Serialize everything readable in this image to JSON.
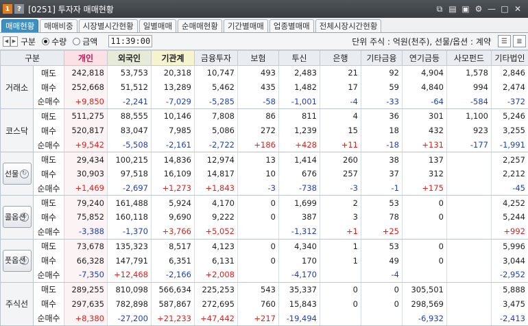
{
  "window": {
    "badge_one": "1",
    "badge_q": "?",
    "title": "[0251] 투자자 매매현황",
    "icons": [
      "link-icon",
      "export-icon",
      "camera-icon",
      "gear-icon",
      "minimize-icon",
      "maximize-icon",
      "close-icon"
    ]
  },
  "tabs": [
    "매매현황",
    "매매비중",
    "시장별시간현황",
    "일별매매",
    "순매매현황",
    "기간별매매",
    "업종별매매",
    "전체시장시간현황"
  ],
  "active_tab": 0,
  "toolbar": {
    "label": "구분",
    "radio_qty": "수량",
    "radio_amt": "금액",
    "time": "11:39:00",
    "unit": "단위 주식 : 억원(천주), 선물/옵션 : 계약"
  },
  "headers": [
    "구분",
    "개인",
    "외국인",
    "기관계",
    "금융투자",
    "보험",
    "투신",
    "은행",
    "기타금융",
    "연기금등",
    "사모펀드",
    "기타법인"
  ],
  "row_labels": {
    "sell": "매도",
    "buy": "매수",
    "net": "순매수"
  },
  "groups": [
    {
      "name": "거래소",
      "button": false,
      "sell": [
        "242,818",
        "53,753",
        "20,318",
        "10,747",
        "493",
        "2,483",
        "21",
        "92",
        "4,904",
        "1,578",
        "2,846"
      ],
      "buy": [
        "252,668",
        "51,512",
        "13,289",
        "5,462",
        "435",
        "1,482",
        "17",
        "59",
        "4,840",
        "994",
        "2,474"
      ],
      "net": [
        "+9,850",
        "-2,241",
        "-7,029",
        "-5,285",
        "-58",
        "-1,001",
        "-4",
        "-33",
        "-64",
        "-584",
        "-372"
      ]
    },
    {
      "name": "코스닥",
      "button": false,
      "sell": [
        "511,275",
        "88,555",
        "10,146",
        "7,808",
        "86",
        "811",
        "4",
        "36",
        "301",
        "1,100",
        "5,246"
      ],
      "buy": [
        "520,817",
        "83,047",
        "7,985",
        "5,086",
        "272",
        "1,239",
        "15",
        "18",
        "432",
        "923",
        "3,255"
      ],
      "net": [
        "+9,542",
        "-5,508",
        "-2,161",
        "-2,722",
        "+186",
        "+428",
        "+11",
        "-18",
        "+131",
        "-177",
        "-1,991"
      ]
    },
    {
      "name": "선물",
      "button": true,
      "sell": [
        "29,434",
        "100,215",
        "14,836",
        "12,974",
        "13",
        "1,414",
        "260",
        "38",
        "137",
        "",
        "2,257"
      ],
      "buy": [
        "30,903",
        "97,518",
        "16,109",
        "14,817",
        "10",
        "676",
        "257",
        "37",
        "312",
        "",
        "2,212"
      ],
      "net": [
        "+1,469",
        "-2,697",
        "+1,273",
        "+1,843",
        "-3",
        "-738",
        "-3",
        "-1",
        "+175",
        "",
        "-45"
      ]
    },
    {
      "name": "콜옵션",
      "button": true,
      "sell": [
        "79,240",
        "161,488",
        "5,924",
        "4,170",
        "0",
        "1,699",
        "2",
        "53",
        "0",
        "",
        "4,252"
      ],
      "buy": [
        "75,852",
        "160,118",
        "9,690",
        "9,222",
        "0",
        "387",
        "3",
        "78",
        "0",
        "",
        "5,244"
      ],
      "net": [
        "-3,388",
        "-1,370",
        "+3,766",
        "+5,052",
        "",
        "-1,312",
        "+1",
        "+25",
        "",
        "",
        "+992"
      ]
    },
    {
      "name": "풋옵션",
      "button": true,
      "sell": [
        "73,678",
        "135,323",
        "8,517",
        "4,123",
        "0",
        "4,340",
        "1",
        "53",
        "0",
        "",
        "5,996"
      ],
      "buy": [
        "66,328",
        "147,791",
        "6,351",
        "6,131",
        "0",
        "170",
        "1",
        "49",
        "0",
        "",
        "3,044"
      ],
      "net": [
        "-7,350",
        "+12,468",
        "-2,166",
        "+2,008",
        "",
        "-4,170",
        "",
        "-4",
        "",
        "",
        "-2,952"
      ]
    },
    {
      "name": "주식선",
      "button": false,
      "sell": [
        "289,255",
        "810,098",
        "566,634",
        "225,253",
        "543",
        "35,337",
        "0",
        "0",
        "305,501",
        "",
        "5,888"
      ],
      "buy": [
        "297,635",
        "782,898",
        "587,867",
        "272,695",
        "760",
        "15,843",
        "0",
        "0",
        "298,569",
        "",
        "3,475"
      ],
      "net": [
        "+8,380",
        "-27,200",
        "+21,233",
        "+47,442",
        "+217",
        "-19,494",
        "",
        "",
        "-6,932",
        "",
        "-2,413"
      ]
    }
  ],
  "colors": {
    "positive": "#e0201b",
    "negative": "#1d3fbf",
    "active_tab": "#3d8fbf",
    "titlebar": "#3a3e43"
  }
}
